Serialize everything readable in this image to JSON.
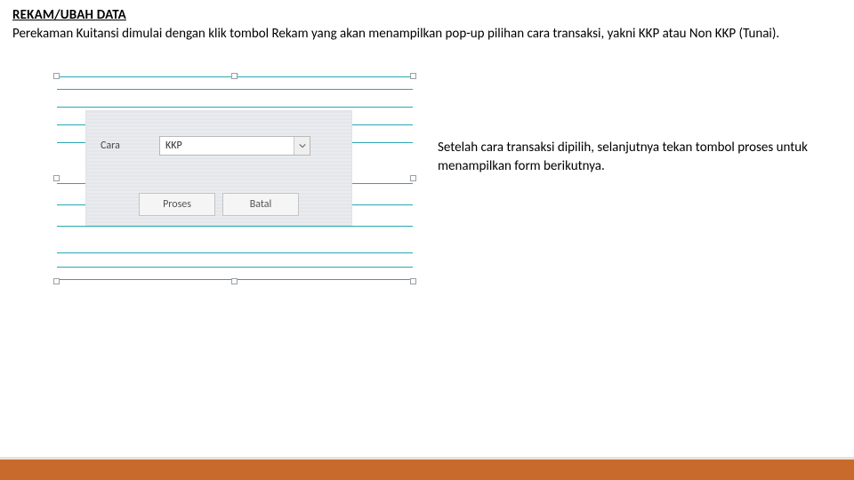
{
  "heading": "REKAM/UBAH DATA",
  "intro": "Perekaman Kuitansi dimulai dengan klik tombol Rekam yang akan menampilkan pop-up pilihan cara transaksi, yakni KKP atau Non KKP (Tunai).",
  "popup": {
    "field_label": "Cara",
    "select_value": "KKP",
    "proses_label": "Proses",
    "batal_label": "Batal"
  },
  "right_text": "Setelah cara transaksi dipilih, selanjutnya tekan tombol proses untuk menampilkan form berikutnya."
}
